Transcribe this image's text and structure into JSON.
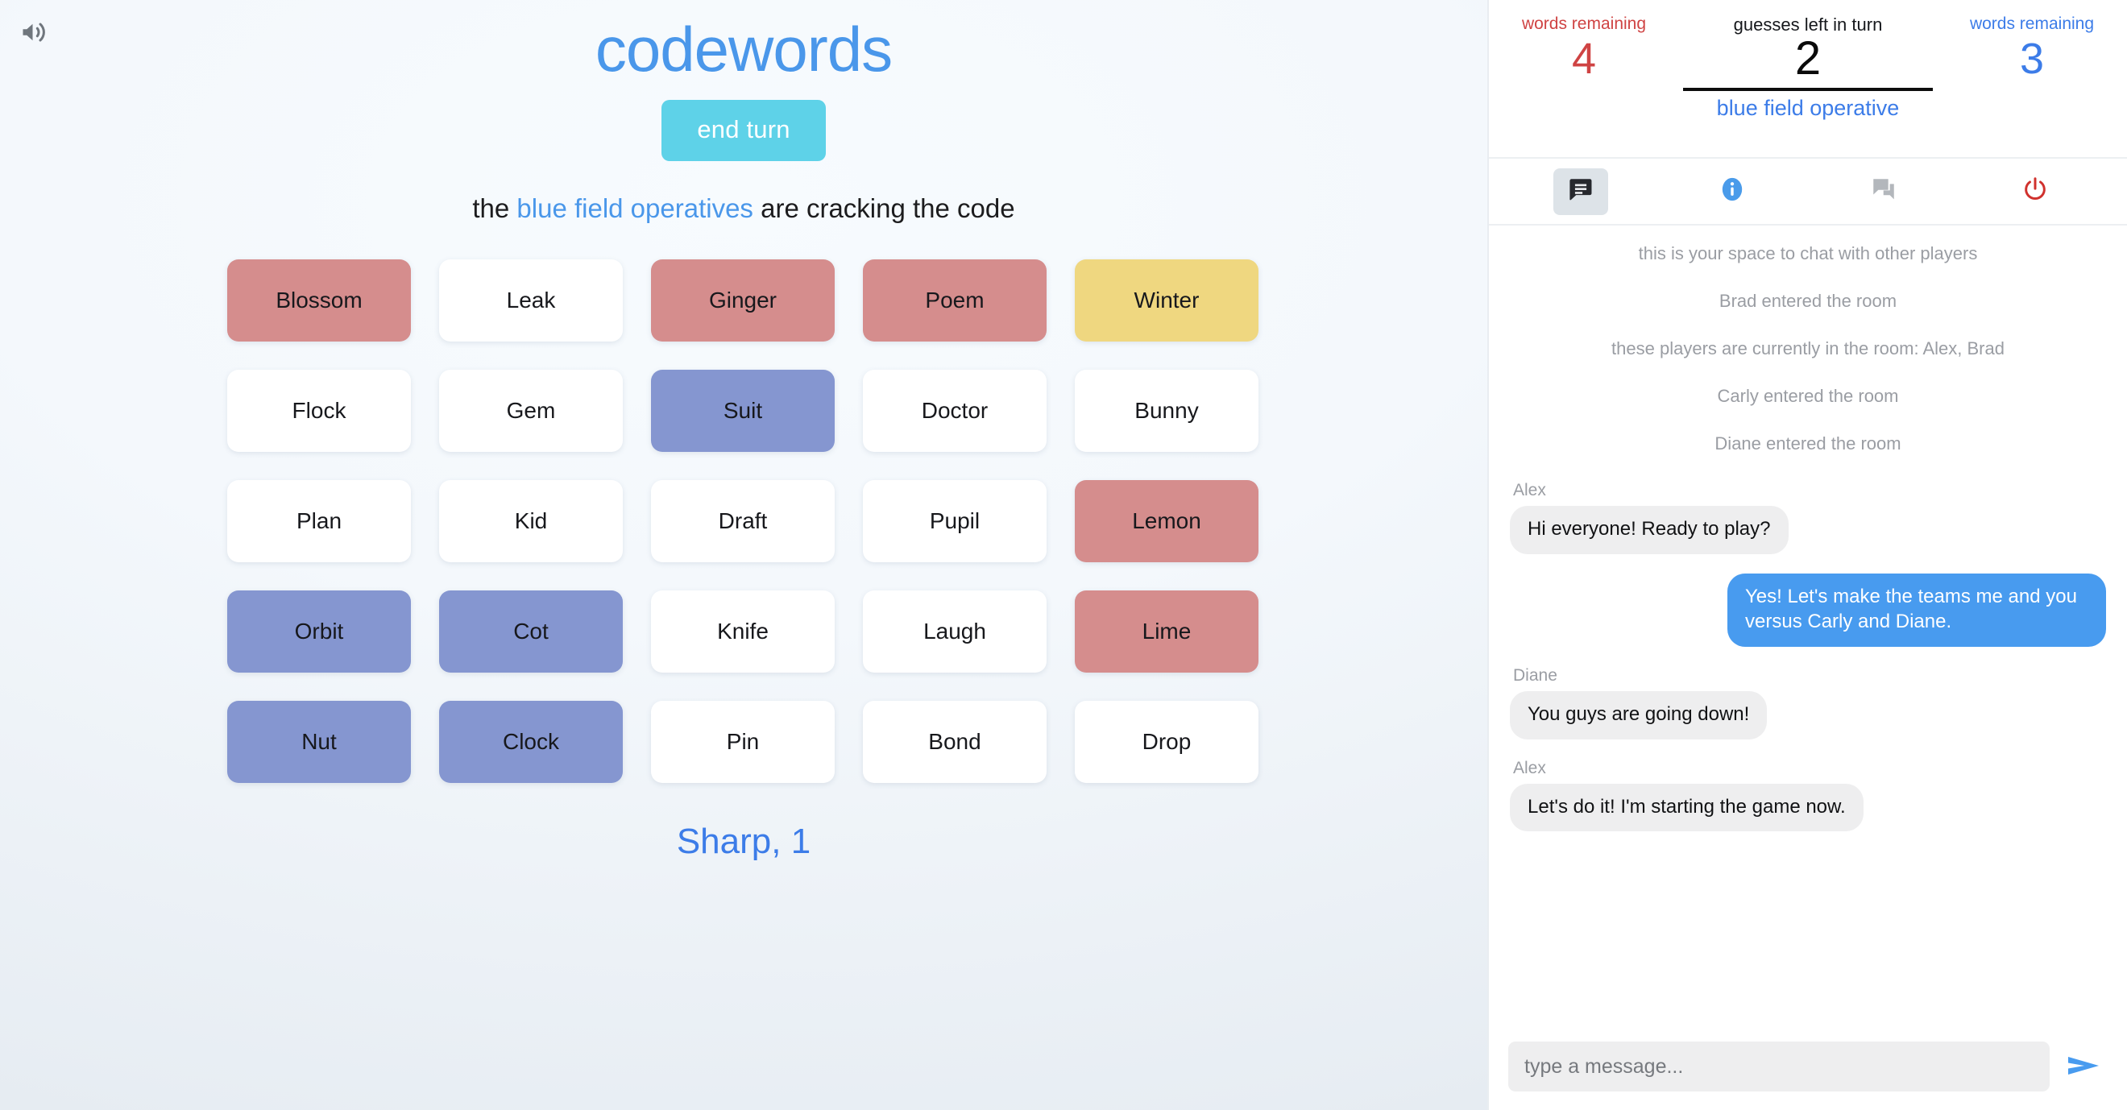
{
  "app": {
    "title": "codewords",
    "title_color": "#4a97ea"
  },
  "sound": {
    "icon": "volume-up-icon",
    "color": "#6f767d"
  },
  "toolbar": {
    "end_turn_label": "end turn",
    "end_turn_color": "#5ed2e8"
  },
  "turn_status": {
    "prefix": "the ",
    "team": "blue field operatives",
    "suffix": " are cracking the code"
  },
  "board": {
    "columns": 5,
    "rows": 5,
    "colors": {
      "red": "#d58d8d",
      "blue": "#8596d0",
      "gold": "#efd780",
      "neutral": "#ffffff"
    },
    "cards": [
      {
        "word": "Blossom",
        "color": "red"
      },
      {
        "word": "Leak",
        "color": "neutral"
      },
      {
        "word": "Ginger",
        "color": "red"
      },
      {
        "word": "Poem",
        "color": "red"
      },
      {
        "word": "Winter",
        "color": "gold"
      },
      {
        "word": "Flock",
        "color": "neutral"
      },
      {
        "word": "Gem",
        "color": "neutral"
      },
      {
        "word": "Suit",
        "color": "blue"
      },
      {
        "word": "Doctor",
        "color": "neutral"
      },
      {
        "word": "Bunny",
        "color": "neutral"
      },
      {
        "word": "Plan",
        "color": "neutral"
      },
      {
        "word": "Kid",
        "color": "neutral"
      },
      {
        "word": "Draft",
        "color": "neutral"
      },
      {
        "word": "Pupil",
        "color": "neutral"
      },
      {
        "word": "Lemon",
        "color": "red"
      },
      {
        "word": "Orbit",
        "color": "blue"
      },
      {
        "word": "Cot",
        "color": "blue"
      },
      {
        "word": "Knife",
        "color": "neutral"
      },
      {
        "word": "Laugh",
        "color": "neutral"
      },
      {
        "word": "Lime",
        "color": "red"
      },
      {
        "word": "Nut",
        "color": "blue"
      },
      {
        "word": "Clock",
        "color": "blue"
      },
      {
        "word": "Pin",
        "color": "neutral"
      },
      {
        "word": "Bond",
        "color": "neutral"
      },
      {
        "word": "Drop",
        "color": "neutral"
      }
    ]
  },
  "clue": {
    "text": "Sharp, 1",
    "color": "#3c7ce8"
  },
  "scoreboard": {
    "red": {
      "label": "words remaining",
      "value": "4",
      "color": "#cf4343"
    },
    "center": {
      "label": "guesses left in turn",
      "value": "2",
      "role": "blue field operative",
      "role_color": "#3c7ce8"
    },
    "blue": {
      "label": "words remaining",
      "value": "3",
      "color": "#3c7ce8"
    }
  },
  "tabs": [
    {
      "name": "chat",
      "icon": "chat-bubble-icon",
      "active": true
    },
    {
      "name": "info",
      "icon": "info-circle-icon",
      "active": false
    },
    {
      "name": "feedback",
      "icon": "forum-bubble-icon",
      "active": false
    },
    {
      "name": "leave-game",
      "icon": "power-off-icon",
      "active": false
    }
  ],
  "chat": {
    "system_messages": [
      "this is your space to chat with other players",
      "Brad entered the room",
      "these players are currently in the room: Alex, Brad",
      "Carly entered the room",
      "Diane entered the room"
    ],
    "messages": [
      {
        "author": "Alex",
        "text": "Hi everyone! Ready to play?",
        "outgoing": false
      },
      {
        "author": "",
        "text": "Yes! Let's make the teams me and you versus Carly and Diane.",
        "outgoing": true
      },
      {
        "author": "Diane",
        "text": "You guys are going down!",
        "outgoing": false
      },
      {
        "author": "Alex",
        "text": "Let's do it! I'm starting the game now.",
        "outgoing": false
      }
    ]
  },
  "composer": {
    "placeholder": "type a message...",
    "value": "",
    "send_icon": "send-arrow-icon",
    "send_color": "#489bef"
  }
}
